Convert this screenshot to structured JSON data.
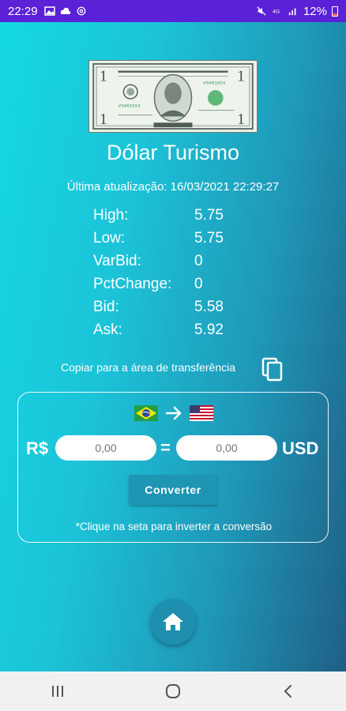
{
  "status_bar": {
    "time": "22:29",
    "battery_text": "12%",
    "icons": [
      "gallery-icon",
      "cloud-icon",
      "at-icon",
      "mute-icon",
      "data-icon",
      "signal-icon",
      "battery-icon"
    ]
  },
  "app": {
    "title": "Dólar Turismo",
    "last_update": "Última atualização: 16/03/2021 22:29:27"
  },
  "quote": [
    {
      "label": "High:",
      "value": "5.75"
    },
    {
      "label": "Low:",
      "value": "5.75"
    },
    {
      "label": "VarBid:",
      "value": "0"
    },
    {
      "label": "PctChange:",
      "value": "0"
    },
    {
      "label": "Bid:",
      "value": "5.58"
    },
    {
      "label": "Ask:",
      "value": "5.92"
    }
  ],
  "copy": {
    "text": "Copiar para a área de transferência",
    "icon": "copy-icon"
  },
  "converter": {
    "from_currency": "R$",
    "to_currency": "USD",
    "from_placeholder": "0,00",
    "to_placeholder": "0,00",
    "equals": "=",
    "button_label": "Converter",
    "hint": "*Clique na seta para inverter a conversão",
    "from_flag": "brazil-flag-icon",
    "to_flag": "usa-flag-icon"
  },
  "colors": {
    "status_bar": "#5b21d6",
    "gradient_start": "#14d8e2",
    "gradient_end": "#1f5f85",
    "button": "#1f95b4"
  }
}
